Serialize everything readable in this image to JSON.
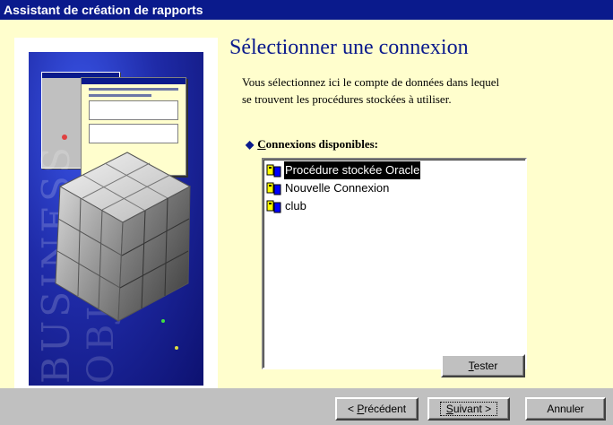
{
  "window": {
    "title": "Assistant de création de rapports"
  },
  "page": {
    "heading": "Sélectionner une connexion",
    "description": "Vous sélectionnez ici le compte de données dans lequel se trouvent les procédures stockées à utiliser."
  },
  "connections": {
    "label_prefix": "",
    "label_hotkey": "C",
    "label_rest": "onnexions disponibles:",
    "items": [
      {
        "label": "Procédure stockée Oracle",
        "selected": true
      },
      {
        "label": "Nouvelle Connexion",
        "selected": false
      },
      {
        "label": "club",
        "selected": false
      }
    ]
  },
  "buttons": {
    "test_hotkey": "T",
    "test_rest": "ester",
    "prev_prefix": "< ",
    "prev_hotkey": "P",
    "prev_rest": "récédent",
    "next_hotkey": "S",
    "next_rest": "uivant >",
    "cancel": "Annuler"
  },
  "illustration": {
    "watermark_1": "BUSINESS",
    "watermark_2": "OBJECTS"
  },
  "colors": {
    "title_bar": "#0a1a8c",
    "content_bg": "#fffecd",
    "heading": "#0a1a8c",
    "selection_bg": "#000000"
  }
}
